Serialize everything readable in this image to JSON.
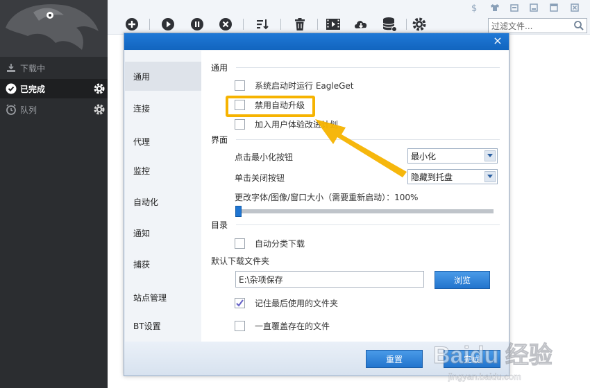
{
  "sidebar": {
    "items": [
      {
        "label": "下载中",
        "icon": "download-icon"
      },
      {
        "label": "已完成",
        "icon": "check-circle-icon"
      },
      {
        "label": "队列",
        "icon": "clock-icon"
      }
    ]
  },
  "toolbar": {
    "icons": [
      "add-icon",
      "play-icon",
      "pause-icon",
      "stop-icon",
      "sort-icon",
      "trash-icon",
      "video-icon",
      "cloud-download-icon",
      "database-icon",
      "gear-icon"
    ],
    "filter_placeholder": "过滤文件..."
  },
  "window_controls": [
    "dollar-icon",
    "shirt-icon",
    "restore-icon",
    "minimize-icon",
    "maximize-icon",
    "close-icon"
  ],
  "dialog": {
    "close_label": "×",
    "categories": [
      "通用",
      "连接",
      "代理",
      "监控",
      "自动化",
      "通知",
      "捕获",
      "站点管理",
      "BT设置"
    ],
    "active_category": "通用",
    "general": {
      "section_general": "通用",
      "opt_startup": "系统启动时运行 EagleGet",
      "opt_disable_upgrade": "禁用自动升级",
      "opt_join_program": "加入用户体验改进计划",
      "section_ui": "界面",
      "minimize_label": "点击最小化按钮",
      "minimize_value": "最小化",
      "close_label": "单击关闭按钮",
      "close_value": "隐藏到托盘",
      "font_size_label": "更改字体/图像/窗口大小（需要重新启动）：100%",
      "font_size_percent": 100,
      "section_dir": "目录",
      "opt_auto_classify": "自动分类下载",
      "default_folder_label": "默认下载文件夹",
      "default_folder_value": "E:\\杂项保存",
      "browse_button": "浏览",
      "opt_remember_folder": "记住最后使用的文件夹",
      "opt_overwrite": "一直覆盖存在的文件"
    },
    "footer": {
      "reset_button": "重置",
      "finish_button": "完成"
    }
  },
  "watermark": {
    "brand": "Baidu 经验",
    "url": "jingyan.baidu.com"
  },
  "colors": {
    "accent": "#1f75d2",
    "highlight": "#f6b300",
    "sidebar": "#2b2d30"
  }
}
